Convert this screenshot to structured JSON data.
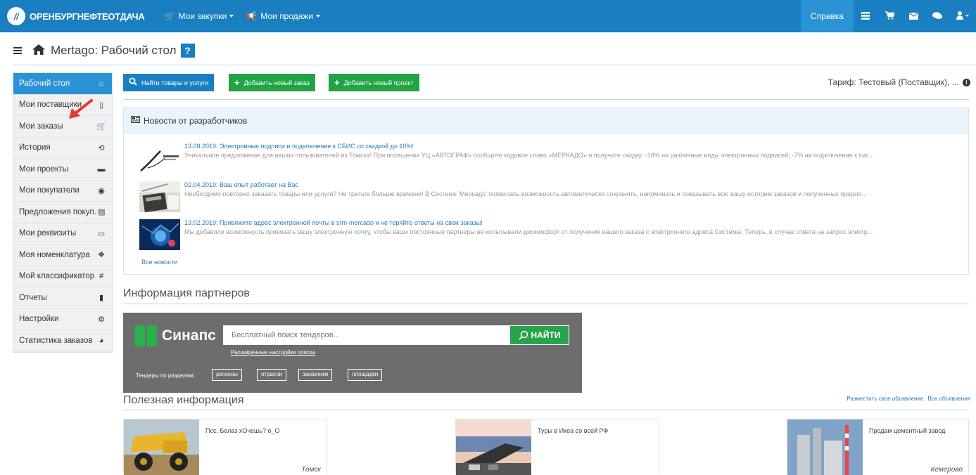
{
  "topbar": {
    "brand": "ОРЕНБУРГНЕФТЕОТДАЧА",
    "brand_logo": "//",
    "nav": [
      {
        "icon": "cart-icon",
        "label": "Мои закупки"
      },
      {
        "icon": "megaphone-icon",
        "label": "Мои продажи"
      }
    ],
    "help": "Справка",
    "right_icons": [
      "list-icon",
      "cart-icon",
      "mail-icon",
      "chat-icon",
      "user-icon"
    ]
  },
  "header": {
    "title": "Mertago: Рабочий стол",
    "help_mark": "?"
  },
  "sidebar": {
    "items": [
      {
        "label": "Рабочий стол",
        "icon": "home-icon",
        "active": true
      },
      {
        "label": "Мои поставщики",
        "icon": "book-icon"
      },
      {
        "label": "Мои заказы",
        "icon": "cart-icon"
      },
      {
        "label": "История",
        "icon": "history-icon"
      },
      {
        "label": "Мои проекты",
        "icon": "briefcase-icon"
      },
      {
        "label": "Мои покупатели",
        "icon": "eye-icon"
      },
      {
        "label": "Предложения покуп...",
        "icon": "document-icon"
      },
      {
        "label": "Мои реквизиты",
        "icon": "id-card-icon"
      },
      {
        "label": "Моя номенклатура",
        "icon": "cubes-icon"
      },
      {
        "label": "Мой классификатор",
        "icon": "hash-icon"
      },
      {
        "label": "Отчеты",
        "icon": "file-icon"
      },
      {
        "label": "Настройки",
        "icon": "gears-icon"
      },
      {
        "label": "Статистика заказов",
        "icon": "pie-chart-icon"
      }
    ]
  },
  "toolbar": {
    "find": "Найти товары и услуги",
    "add_order": "Добавить новый заказ",
    "add_project": "Добавить новый проект",
    "tariff": "Тариф: Тестовый (Поставщик), ..."
  },
  "news": {
    "header": "Новости от разработчиков",
    "items": [
      {
        "title": "13.08.2019: Электронные подписи и подключение к СБИС со скидкой до 10%!",
        "text": "Уникальное предложение для наших пользователей из Томска! При посещении УЦ «АВТОГРАФ» сообщите кодовое слово «МЕРКАДО» и получите скидку: -10% на различные виды электронных подписей; -7% на подключение к сис..."
      },
      {
        "title": "02.04.2019: Ваш опыт работает на Вас",
        "text": "Необходимо повторно заказать товары или услуги? Не тратьте больше времени! В Системе 'Меркадо' появилась возможность автоматически сохранять, напоминать и показывать всю вашу историю заказов и полученных предло..."
      },
      {
        "title": "13.02.2019: Привяжите адрес электронной почты в srm-mercado и не теряйте ответы на свои заказы!",
        "text": "Мы добавили возможность привязать вашу электронную почту, чтобы ваши постоянные партнеры не испытывали дискомфорт от получения вашего заказа с электронного адреса Системы. Теперь, в случае ответа на запрос электр..."
      }
    ],
    "all": "Все новости"
  },
  "partners": {
    "title": "Информация партнеров",
    "synaps": {
      "logo": "Синапс",
      "placeholder": "Бесплатный поиск тендеров...",
      "search": "НАЙТИ",
      "advanced": "Расширенные настройки поиска",
      "sections_label": "Тендеры по разделам:",
      "tags": [
        "регионы",
        "отрасли",
        "заказчики",
        "площадки"
      ]
    }
  },
  "useful": {
    "title": "Полезная информация",
    "links": [
      "Разместить свое объявление",
      "Все объявления"
    ],
    "cards": [
      {
        "title": "Псс, Белаз хОчешь? о_О",
        "city": "Томск"
      },
      {
        "title": "Туры в Икеа со всей РФ",
        "city": ""
      },
      {
        "title": "Продам цементный завод",
        "city": "Кемерово"
      }
    ]
  },
  "colors": {
    "brand_blue": "#1a7fc1",
    "active_blue": "#2a93d6",
    "green": "#22a344"
  }
}
